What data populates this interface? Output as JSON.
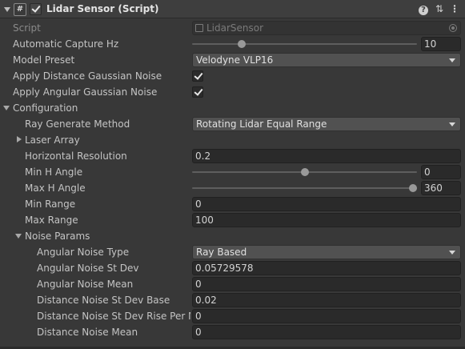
{
  "header": {
    "title": "Lidar Sensor (Script)",
    "script_icon_glyph": "#",
    "enabled": true,
    "icons": [
      "help-icon",
      "preset-icon",
      "context-menu-icon"
    ]
  },
  "script": {
    "label": "Script",
    "value": "LidarSensor"
  },
  "capture_hz": {
    "label": "Automatic Capture Hz",
    "value": "10",
    "slider_fraction": 0.21
  },
  "model_preset": {
    "label": "Model Preset",
    "value": "Velodyne VLP16"
  },
  "distance_noise": {
    "label": "Apply Distance Gaussian Noise",
    "checked": true
  },
  "angular_noise": {
    "label": "Apply Angular Gaussian Noise",
    "checked": true
  },
  "configuration": {
    "label": "Configuration",
    "ray_method": {
      "label": "Ray Generate Method",
      "value": "Rotating Lidar Equal Range"
    },
    "laser_array": {
      "label": "Laser Array"
    },
    "horizontal_resolution": {
      "label": "Horizontal Resolution",
      "value": "0.2"
    },
    "min_h_angle": {
      "label": "Min H Angle",
      "value": "0",
      "slider_fraction": 0.5
    },
    "max_h_angle": {
      "label": "Max H Angle",
      "value": "360",
      "slider_fraction": 1.0
    },
    "min_range": {
      "label": "Min Range",
      "value": "0"
    },
    "max_range": {
      "label": "Max Range",
      "value": "100"
    }
  },
  "noise_params": {
    "label": "Noise Params",
    "angular_noise_type": {
      "label": "Angular Noise Type",
      "value": "Ray Based"
    },
    "angular_noise_st_dev": {
      "label": "Angular Noise St Dev",
      "value": "0.05729578"
    },
    "angular_noise_mean": {
      "label": "Angular Noise Mean",
      "value": "0"
    },
    "distance_noise_st_dev_base": {
      "label": "Distance Noise St Dev Base",
      "value": "0.02"
    },
    "distance_noise_st_dev_rise": {
      "label": "Distance Noise St Dev Rise Per Me",
      "value": "0"
    },
    "distance_noise_mean": {
      "label": "Distance Noise Mean",
      "value": "0"
    }
  }
}
